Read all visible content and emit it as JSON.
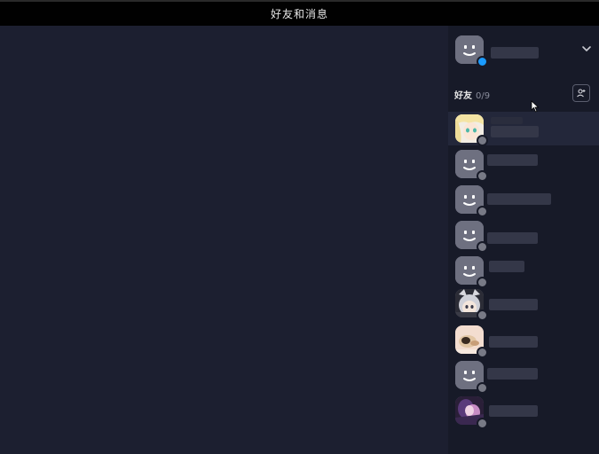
{
  "window": {
    "title": "好友和消息"
  },
  "profile": {
    "status": "online",
    "dropdown_icon": "chevron-down-icon"
  },
  "friends": {
    "label": "好友",
    "count": "0/9",
    "add_icon": "add-friend-icon",
    "items": [
      {
        "avatar": "anime-blonde-girl",
        "status": "offline",
        "selected": true
      },
      {
        "avatar": "default-face",
        "status": "offline"
      },
      {
        "avatar": "default-face",
        "status": "offline"
      },
      {
        "avatar": "default-face",
        "status": "offline"
      },
      {
        "avatar": "default-face",
        "status": "offline"
      },
      {
        "avatar": "anime-silver-hair-girl",
        "status": "offline"
      },
      {
        "avatar": "anime-cat-photo",
        "status": "offline"
      },
      {
        "avatar": "default-face",
        "status": "offline"
      },
      {
        "avatar": "anime-dark-purple",
        "status": "offline"
      }
    ]
  },
  "colors": {
    "titlebar_bg": "#010101",
    "main_bg": "#1c1f30",
    "sidebar_bg": "#171a28",
    "selected_row_bg": "#23273a",
    "online_dot": "#1a9bff",
    "offline_dot": "#787a86"
  }
}
